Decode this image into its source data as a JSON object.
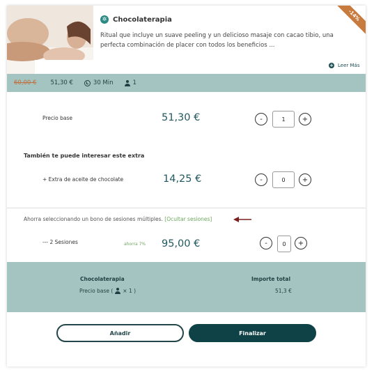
{
  "product": {
    "name": "Chocolaterapia",
    "description": "Ritual que incluye un suave peeling y un delicioso masaje con cacao tibio, una perfecta combinación de placer con todos los beneficios ...",
    "read_more_label": "Leer Más",
    "discount_ribbon": "-14%",
    "icon": "brand-circle-icon"
  },
  "info_bar": {
    "old_price": "60,00 €",
    "new_price": "51,30 €",
    "duration": "30 Min",
    "people": "1"
  },
  "base": {
    "label": "Precio base",
    "price": "51,30 €",
    "quantity": "1",
    "minus": "-",
    "plus": "+"
  },
  "extras": {
    "heading": "También te puede interesar este extra",
    "items": [
      {
        "label": "+ Extra de aceite de chocolate",
        "price": "14,25 €",
        "quantity": "0",
        "minus": "-",
        "plus": "+"
      }
    ]
  },
  "bono": {
    "text": "Ahorra seleccionando un bono de sesiones múltiples.",
    "hide_link": "[Ocultar sesiones]",
    "items": [
      {
        "label": "--- 2 Sesiones",
        "saving": "ahorra 7%",
        "price": "95,00 €",
        "quantity": "0",
        "minus": "-",
        "plus": "+"
      }
    ]
  },
  "summary": {
    "product_name": "Chocolaterapia",
    "line_text": "Precio base (",
    "line_qty": "× 1 )",
    "total_label": "Importe total",
    "total_value": "51,3 €"
  },
  "actions": {
    "add_label": "Añadir",
    "finish_label": "Finalizar"
  },
  "colors": {
    "accent_teal": "#a4c4c1",
    "primary_dark": "#0e4247",
    "price_text": "#23595e",
    "link_green": "#6fa860",
    "ribbon": "#c77b3f",
    "arrow": "#7a1e1e"
  }
}
